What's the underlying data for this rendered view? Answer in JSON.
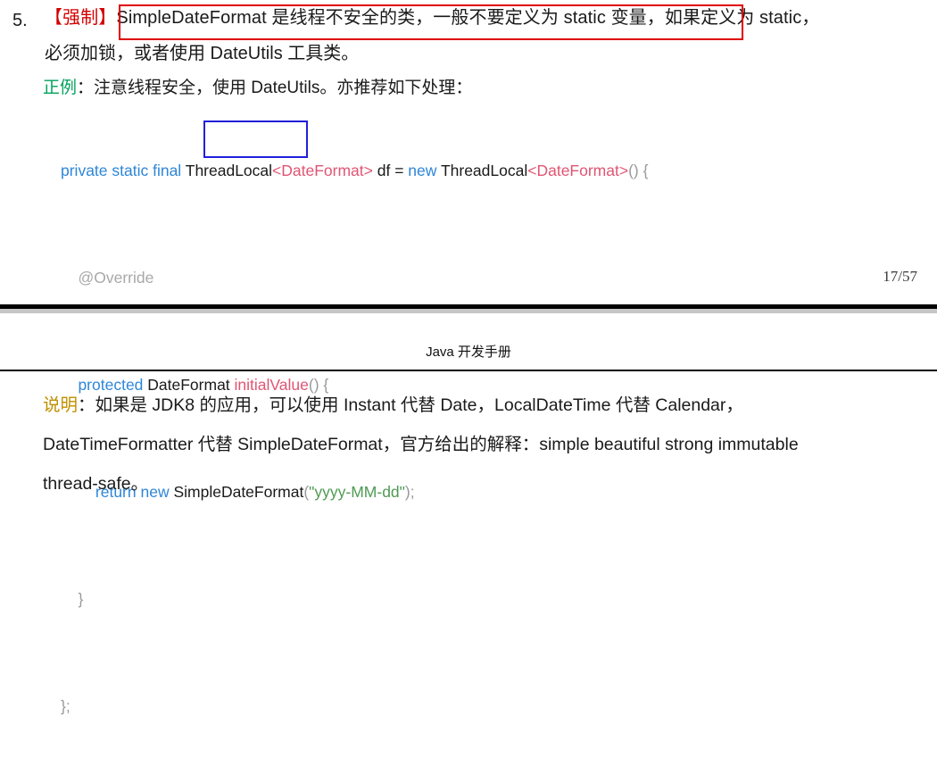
{
  "page_one": {
    "rule_number": "5.",
    "mandatory_tag": "【强制】",
    "rule_text_line1": "SimpleDateFormat 是线程不安全的类，一般不要定义为 static 变量，如果定义为 static，",
    "rule_text_line2": "必须加锁，或者使用 DateUtils 工具类。",
    "example_label": "正例",
    "example_text": "：注意线程安全，使用 DateUtils。亦推荐如下处理：",
    "page_number": "17/57",
    "annotations": {
      "red_box_target": "SimpleDateFormat 是线程不安全的类，一般不要定义为 static 变量",
      "red_box_color": "#e00000",
      "blue_box_target": "ThreadLocal",
      "blue_box_color": "#2020d8"
    },
    "code": {
      "line1": {
        "kw1": "private static final ",
        "type1": "ThreadLocal",
        "generic1": "<DateFormat>",
        "var": " df ",
        "eq": "= ",
        "kw2": "new ",
        "type2": "ThreadLocal",
        "generic2": "<DateFormat>",
        "tail": "() {"
      },
      "line2": {
        "indent": "    ",
        "annotation": "@Override"
      },
      "line3": {
        "indent": "    ",
        "kw": "protected ",
        "type": "DateFormat ",
        "method": "initialValue",
        "tail": "() {"
      },
      "line4": {
        "indent": "        ",
        "kw1": "return ",
        "kw2": "new ",
        "type": "SimpleDateFormat",
        "paren_open": "(",
        "string": "\"yyyy-MM-dd\"",
        "paren_close": ");"
      },
      "line5": {
        "indent": "    ",
        "brace": "}"
      },
      "line6": {
        "indent": "",
        "brace": "};"
      }
    }
  },
  "page_two": {
    "doc_header": "Java 开发手册",
    "note_label": "说明",
    "note_line1": "：如果是 JDK8 的应用，可以使用 Instant 代替 Date，LocalDateTime 代替 Calendar，",
    "note_line2": "DateTimeFormatter 代替 SimpleDateFormat，官方给出的解释：simple beautiful strong immutable",
    "note_line3": "thread-safe。"
  },
  "colors": {
    "mandatory_red": "#d40000",
    "good_example_green": "#00a15c",
    "note_gold": "#bf9000",
    "code_keyword_blue": "#2e86d8",
    "code_class_pink": "#e05573",
    "code_string_green": "#4f9a52",
    "code_annotation_gray": "#a8a8a8"
  }
}
